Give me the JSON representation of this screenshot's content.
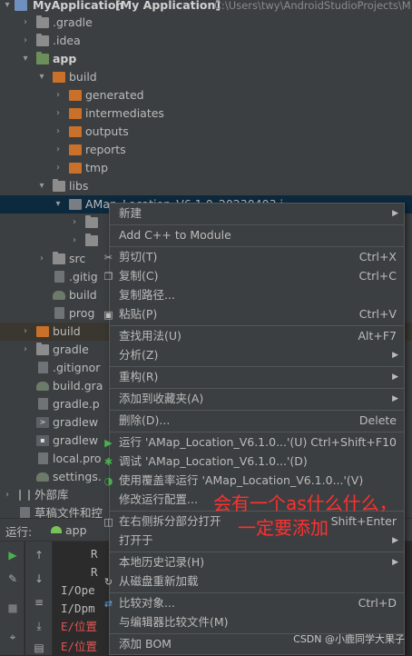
{
  "project_tree": {
    "root": {
      "name": "MyApplication",
      "module": "[My Application]",
      "path": "C:\\Users\\twy\\AndroidStudioProjects\\M"
    },
    "rows": [
      {
        "label": ".gradle"
      },
      {
        "label": ".idea"
      },
      {
        "label": "app"
      },
      {
        "label": "build"
      },
      {
        "label": "generated"
      },
      {
        "label": "intermediates"
      },
      {
        "label": "outputs"
      },
      {
        "label": "reports"
      },
      {
        "label": "tmp"
      },
      {
        "label": "libs"
      },
      {
        "label": "AMap_Location_V6.1.0_20230403.j"
      },
      {
        "label": ""
      },
      {
        "label": ""
      },
      {
        "label": "src"
      },
      {
        "label": ".gitig"
      },
      {
        "label": "build"
      },
      {
        "label": "prog"
      },
      {
        "label": "build"
      },
      {
        "label": "gradle"
      },
      {
        "label": ".gitignor"
      },
      {
        "label": "build.gra"
      },
      {
        "label": "gradle.p"
      },
      {
        "label": "gradlew"
      },
      {
        "label": "gradlew"
      },
      {
        "label": "local.pro"
      },
      {
        "label": "settings."
      },
      {
        "label": "外部库"
      },
      {
        "label": "草稿文件和控"
      }
    ]
  },
  "run_bar": {
    "title": "运行:",
    "tab": "app"
  },
  "console": {
    "lines": [
      {
        "text": "R"
      },
      {
        "text": "R"
      },
      {
        "text": "I/Ope"
      },
      {
        "text": "I/Dpm"
      },
      {
        "text": "E/位置"
      },
      {
        "text": "E/位置"
      }
    ]
  },
  "context_menu": {
    "items": [
      {
        "label": "新建",
        "shortcut": ""
      },
      {
        "label": "Add C++ to Module",
        "shortcut": ""
      },
      {
        "label": "剪切(T)",
        "shortcut": "Ctrl+X"
      },
      {
        "label": "复制(C)",
        "shortcut": "Ctrl+C"
      },
      {
        "label": "复制路径...",
        "shortcut": ""
      },
      {
        "label": "粘贴(P)",
        "shortcut": "Ctrl+V"
      },
      {
        "label": "查找用法(U)",
        "shortcut": "Alt+F7"
      },
      {
        "label": "分析(Z)",
        "shortcut": ""
      },
      {
        "label": "重构(R)",
        "shortcut": ""
      },
      {
        "label": "添加到收藏夹(A)",
        "shortcut": ""
      },
      {
        "label": "删除(D)...",
        "shortcut": "Delete"
      },
      {
        "label": "运行 'AMap_Location_V6.1.0...'(U)",
        "shortcut": "Ctrl+Shift+F10"
      },
      {
        "label": "调试 'AMap_Location_V6.1.0...'(D)",
        "shortcut": ""
      },
      {
        "label": "使用覆盖率运行  'AMap_Location_V6.1.0...'(V)",
        "shortcut": ""
      },
      {
        "label": "修改运行配置...",
        "shortcut": ""
      },
      {
        "label": "在右侧拆分部分打开",
        "shortcut": "Shift+Enter"
      },
      {
        "label": "打开于",
        "shortcut": ""
      },
      {
        "label": "本地历史记录(H)",
        "shortcut": ""
      },
      {
        "label": "从磁盘重新加载",
        "shortcut": ""
      },
      {
        "label": "比较对象...",
        "shortcut": "Ctrl+D"
      },
      {
        "label": "与编辑器比较文件(M)",
        "shortcut": ""
      },
      {
        "label": "添加 BOM",
        "shortcut": ""
      }
    ]
  },
  "annotation": {
    "line1": "会有一个as什么什么，",
    "line2": "一定要添加"
  },
  "watermark": "CSDN @小鹿同学大果子",
  "colors": {
    "accent_orange": "#c9702a",
    "selection": "#0d293e",
    "annotation_red": "#ff3030",
    "run_green": "#4caf50"
  }
}
